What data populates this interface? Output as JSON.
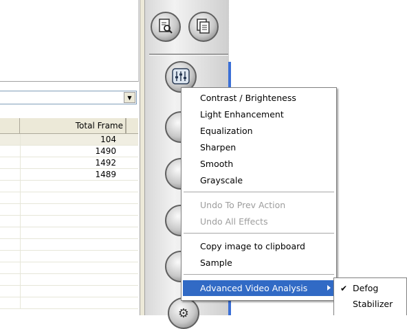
{
  "table": {
    "header": {
      "total_frame": "Total Frame"
    },
    "rows": [
      "104",
      "1490",
      "1492",
      "1489"
    ]
  },
  "context_menu": {
    "items": [
      {
        "label": "Contrast / Brighteness",
        "enabled": true
      },
      {
        "label": "Light Enhancement",
        "enabled": true
      },
      {
        "label": "Equalization",
        "enabled": true
      },
      {
        "label": "Sharpen",
        "enabled": true
      },
      {
        "label": "Smooth",
        "enabled": true
      },
      {
        "label": "Grayscale",
        "enabled": true
      },
      {
        "label": "Undo To Prev Action",
        "enabled": false
      },
      {
        "label": "Undo All Effects",
        "enabled": false
      },
      {
        "label": "Copy image to clipboard",
        "enabled": true
      },
      {
        "label": "Sample",
        "enabled": true
      },
      {
        "label": "Advanced Video Analysis",
        "enabled": true,
        "has_submenu": true
      }
    ]
  },
  "submenu": {
    "items": [
      {
        "label": "Defog",
        "checked": true
      },
      {
        "label": "Stabilizer",
        "checked": false
      }
    ]
  },
  "icons": {
    "find": "find-in-page-icon",
    "pages": "pages-icon",
    "equalizer": "equalizer-icon",
    "settings": "gear-icon"
  },
  "colors": {
    "highlight": "#316ac5",
    "disabled_text": "#9d9d9d"
  }
}
